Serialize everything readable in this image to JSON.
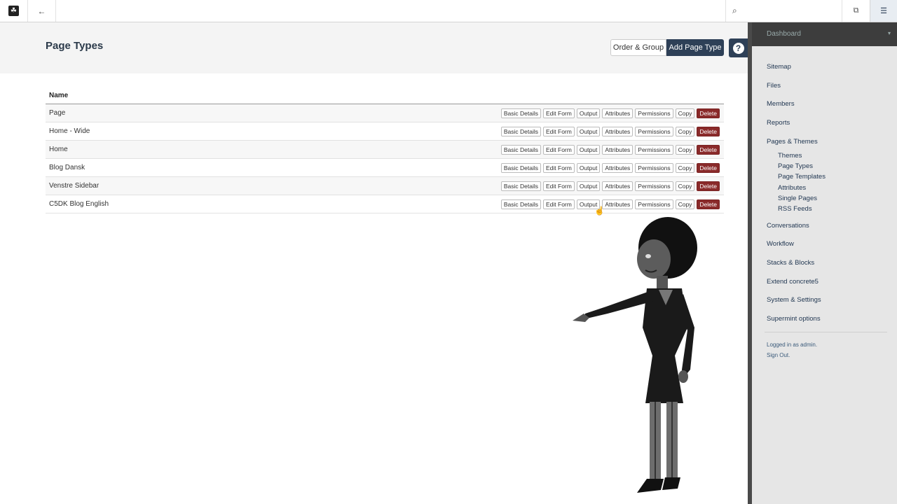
{
  "toolbar": {
    "logo_glyph": "☘",
    "back_glyph": "←",
    "search_glyph": "⌕",
    "search_placeholder": "",
    "intel_glyph": "⧉",
    "dashboard_glyph": "☰"
  },
  "page": {
    "title": "Page Types",
    "order_group_label": "Order & Group",
    "add_label": "Add Page Type",
    "help_glyph": "?"
  },
  "table": {
    "header": "Name",
    "actions": [
      "Basic Details",
      "Edit Form",
      "Output",
      "Attributes",
      "Permissions",
      "Copy",
      "Delete"
    ],
    "rows": [
      {
        "name": "Page"
      },
      {
        "name": "Home - Wide"
      },
      {
        "name": "Home"
      },
      {
        "name": "Blog Dansk"
      },
      {
        "name": "Venstre Sidebar"
      },
      {
        "name": "C5DK Blog English"
      }
    ]
  },
  "panel": {
    "title": "Dashboard",
    "caret": "▾",
    "nav": [
      "Sitemap",
      "Files",
      "Members",
      "Reports",
      "Pages & Themes"
    ],
    "sub": [
      "Themes",
      "Page Types",
      "Page Templates",
      "Attributes",
      "Single Pages",
      "RSS Feeds"
    ],
    "nav2": [
      "Conversations",
      "Workflow",
      "Stacks & Blocks",
      "Extend concrete5",
      "System & Settings",
      "Supermint options"
    ],
    "logged_in": "Logged in as admin.",
    "sign_out": "Sign Out."
  },
  "colors": {
    "accent": "#2e4057",
    "delete": "#8a2a2a"
  }
}
